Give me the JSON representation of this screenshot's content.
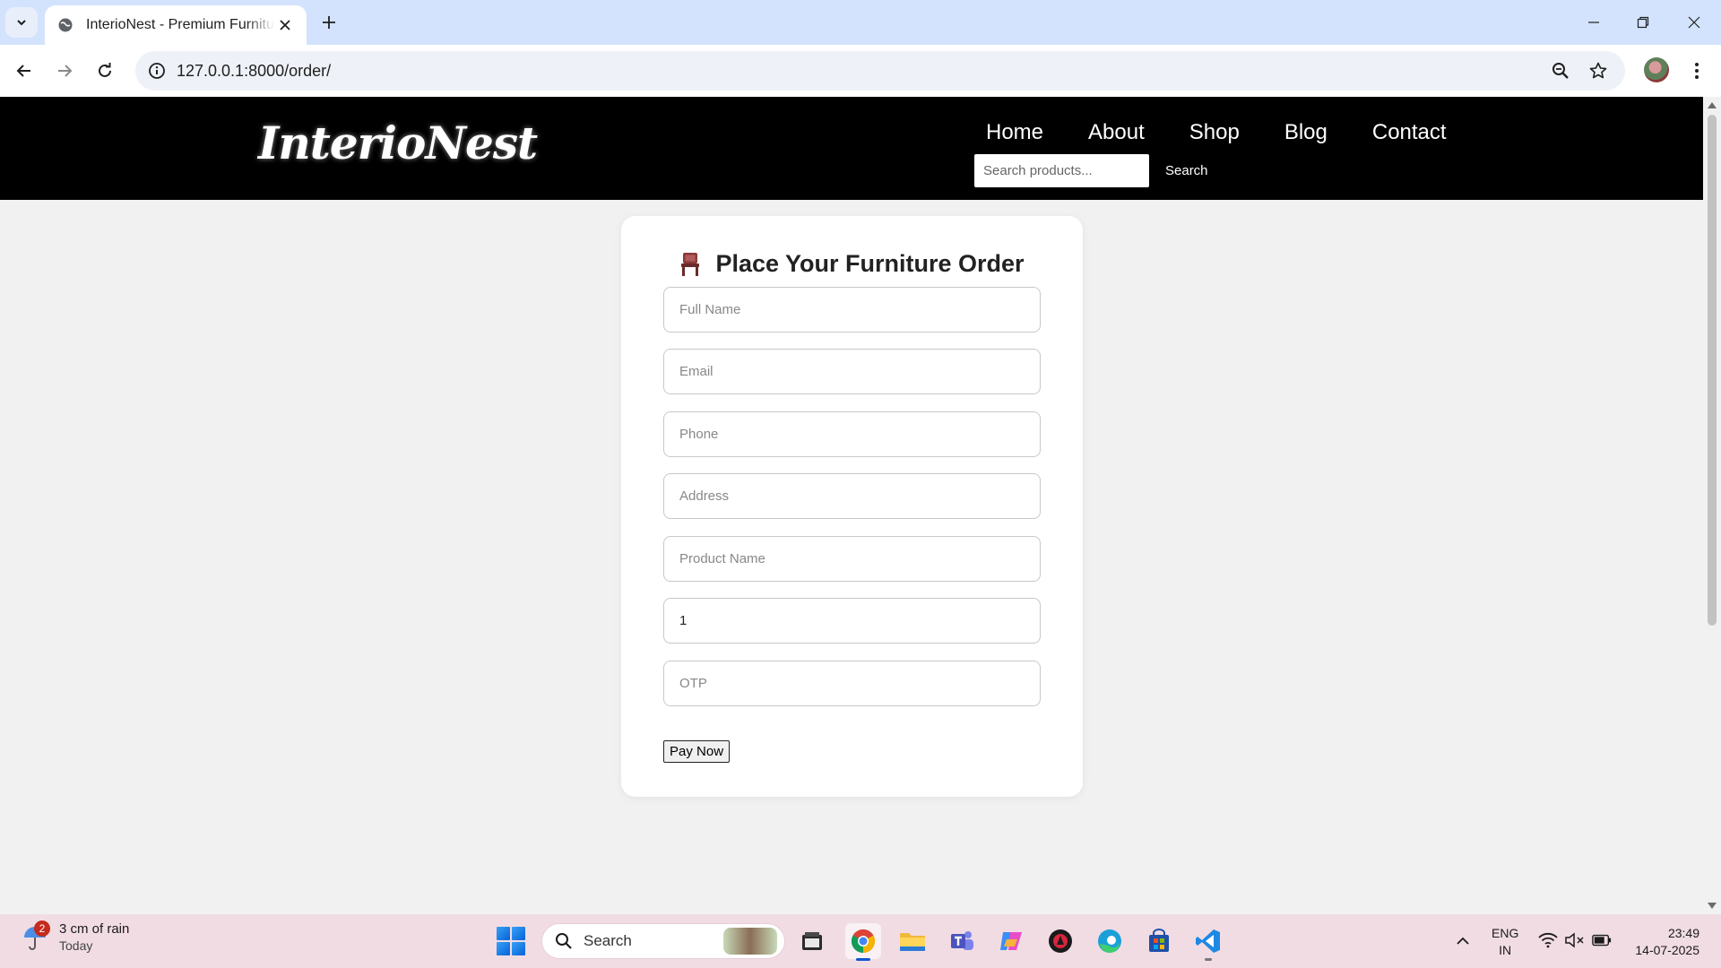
{
  "browser": {
    "tab_title": "InterioNest - Premium Furniture",
    "url": "127.0.0.1:8000/order/",
    "icons": [
      "tab-search-icon",
      "globe-icon",
      "close-icon",
      "plus-icon",
      "minimize-icon",
      "restore-icon",
      "window-close-icon",
      "back-icon",
      "forward-icon",
      "reload-icon",
      "info-icon",
      "zoom-icon",
      "star-icon",
      "kebab-menu-icon"
    ]
  },
  "site": {
    "logo": "InterioNest",
    "nav": [
      "Home",
      "About",
      "Shop",
      "Blog",
      "Contact"
    ],
    "search_placeholder": "Search products...",
    "search_button": "Search"
  },
  "order_form": {
    "title": "Place Your Furniture Order",
    "title_icon": "chair-icon",
    "fields": {
      "full_name_placeholder": "Full Name",
      "email_placeholder": "Email",
      "phone_placeholder": "Phone",
      "address_placeholder": "Address",
      "product_name_placeholder": "Product Name",
      "quantity_value": "1",
      "otp_placeholder": "OTP"
    },
    "pay_button": "Pay Now"
  },
  "taskbar": {
    "weather_badge": "2",
    "weather_line1": "3 cm of rain",
    "weather_line2": "Today",
    "search_label": "Search",
    "apps": [
      "file-explorer-icon",
      "chrome-icon",
      "folder-icon",
      "teams-icon",
      "copilot-icon",
      "app-icon",
      "edge-icon",
      "store-icon",
      "vscode-icon"
    ],
    "lang_line1": "ENG",
    "lang_line2": "IN",
    "time": "23:49",
    "date": "14-07-2025"
  },
  "colors": {
    "header_bg": "#000000",
    "page_bg": "#f1f1f1",
    "tabbar_bg": "#d3e3fd",
    "taskbar_bg": "#f1dce4",
    "chair_icon": "#8b3a3a"
  }
}
